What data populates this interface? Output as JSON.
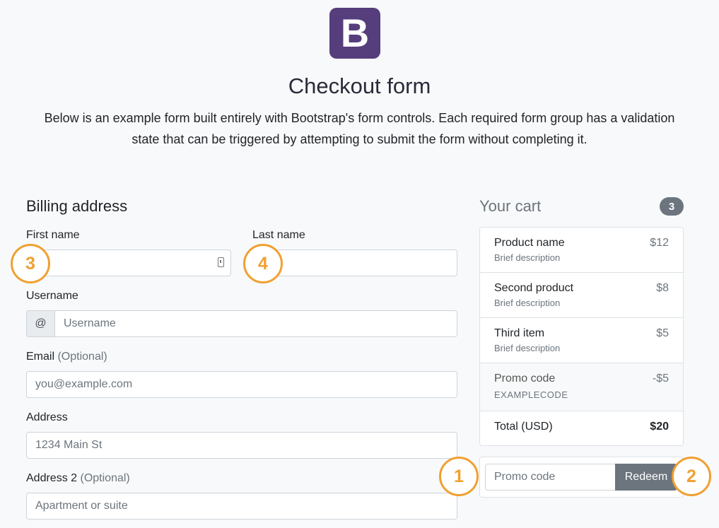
{
  "header": {
    "logo_letter": "B",
    "title": "Checkout form",
    "lead_line1": "Below is an example form built entirely with Bootstrap's form controls. Each required form group has a validation",
    "lead_line2": "state that can be triggered by attempting to submit the form without completing it."
  },
  "billing": {
    "title": "Billing address",
    "first_name_label": "First name",
    "first_name_value": "",
    "last_name_label": "Last name",
    "last_name_value": "",
    "username_label": "Username",
    "username_addon": "@",
    "username_placeholder": "Username",
    "email_label": "Email",
    "email_optional": "(Optional)",
    "email_placeholder": "you@example.com",
    "address_label": "Address",
    "address_placeholder": "1234 Main St",
    "address2_label": "Address 2",
    "address2_optional": "(Optional)",
    "address2_placeholder": "Apartment or suite"
  },
  "cart": {
    "title": "Your cart",
    "count": "3",
    "items": [
      {
        "name": "Product name",
        "desc": "Brief description",
        "price": "$12"
      },
      {
        "name": "Second product",
        "desc": "Brief description",
        "price": "$8"
      },
      {
        "name": "Third item",
        "desc": "Brief description",
        "price": "$5"
      }
    ],
    "promo": {
      "name": "Promo code",
      "code": "EXAMPLECODE",
      "price": "-$5"
    },
    "total": {
      "label": "Total (USD)",
      "value": "$20"
    },
    "promo_input_placeholder": "Promo code",
    "redeem_label": "Redeem"
  },
  "callouts": [
    "1",
    "2",
    "3",
    "4"
  ],
  "colors": {
    "brand": "#563d7c",
    "callout": "#f0a030",
    "secondary": "#6c757d"
  }
}
